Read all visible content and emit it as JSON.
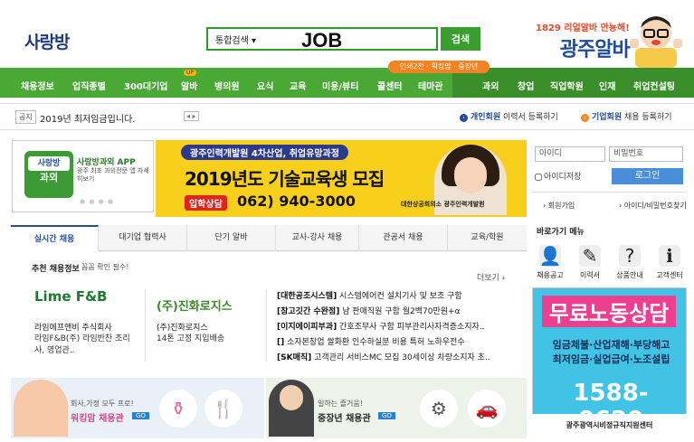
{
  "header": {
    "logo_kr": "사랑방",
    "logo_job": "JOB",
    "search_scope": "통합검색 ▾",
    "search_button": "검색",
    "brand_sub": "1829 리얼알바 안뇽해!",
    "brand_main": "광주알바"
  },
  "nav": {
    "items": [
      "채용정보",
      "업직종별",
      "300대기업",
      "알바",
      "병의원",
      "요식",
      "교육",
      "미용/뷰티",
      "콜센터",
      "테마관",
      "과외",
      "창업",
      "직업학원",
      "인재",
      "취업컨설팅"
    ],
    "up_badge": "UP",
    "popout": "인쇄2천 · 워킹맘 · 중장년"
  },
  "notice": {
    "tag": "공지",
    "text": "2019년 최저임금입니다.",
    "arrows": "◂ ▸",
    "register_personal_bold": "개인회원",
    "register_personal_rest": " 이력서 등록하기",
    "register_corp_bold": "기업회원",
    "register_corp_rest": " 채용 등록하기"
  },
  "app_promo": {
    "logo_top": "사랑방",
    "logo_bottom": "과외",
    "title": "사랑방과외 APP",
    "desc": "광주 최초 과외전문 앱 자세히보기",
    "dots": "● ● ● ●"
  },
  "banner": {
    "pill": "광주인력개발원 4차산업, 취업유망과정",
    "title": "2019년도 기술교육생 모집",
    "call_label": "입학상담",
    "phone": "062) 940-3000",
    "org": "대한상공회의소 광주인력개발원"
  },
  "login": {
    "id_placeholder": "아이디",
    "pw_placeholder": "비밀번호",
    "save_id": "아이디저장",
    "login_button": "로그인",
    "join": "› 회원가입",
    "find": "› 아이디/비밀번호찾기",
    "shortcut_title": "바로가기 메뉴",
    "shortcuts": [
      "채용공고",
      "이력서",
      "상품안내",
      "고객센터"
    ]
  },
  "labor_ad": {
    "title": "무료노동상담",
    "line1": "임금체불·산업재해·부당해고",
    "line2": "최저임금·실업급여·노조설립",
    "phone": "1588-0620",
    "org": "광주광역시비정규직지원센터"
  },
  "tabs": [
    "실시간 채용",
    "대기업 협력사",
    "단기 알바",
    "교사-강사 채용",
    "관공서 채용",
    "교육/학원"
  ],
  "recommend": {
    "label": "추천 채용정보",
    "sub": "꼼꼼 확인 필수!",
    "more": "더보기 ›"
  },
  "companies": [
    {
      "logo": "Lime F&B",
      "name": "라임에프앤비 주식회사",
      "desc1": "라임F&B(주) 라임반찬 조리",
      "desc2": "사, 영업관.."
    },
    {
      "logo": "(주)진화로지스",
      "name": "(주)진화로지스",
      "desc1": "14톤 고정 지입배송",
      "desc2": ""
    }
  ],
  "jobs": [
    {
      "tag": "[대한공조시스템]",
      "text": " 시스템에어컨 설치기사 및 보조 구함"
    },
    {
      "tag": "[참고깃간 수완점]",
      "text": " 남 판매직원 구함 월2백70만원+α"
    },
    {
      "tag": "[이지에이피부과]",
      "text": " 간호조무사 구함 피부관리사자격증소지자.."
    },
    {
      "tag": "[]",
      "text": " 소자본창업 쌀화환 인수하실분 비용 특허 노하우전수"
    },
    {
      "tag": "[SK매직]",
      "text": " 고객관리 서비스MC 모집 30세이상 차량소지자 초.."
    }
  ],
  "bottom": {
    "b1_small": "회사,가정 모두 프로!",
    "b1_main": "워킹맘 채용관",
    "b1_go": "GO",
    "b2_small": "일하는 즐거움!",
    "b2_main": "중장년 채용관",
    "b2_go": "GO"
  },
  "colors": {
    "nav_green": "#4aa835",
    "brand_blue": "#1f4c9a",
    "banner_yellow": "#f8cf1a",
    "labor_blue": "#41c3e6",
    "labor_pink": "#ec3f8f"
  }
}
